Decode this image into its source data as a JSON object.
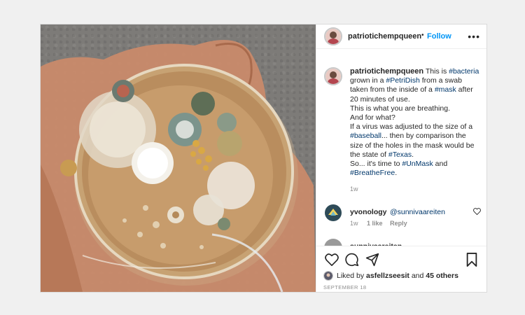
{
  "post": {
    "username": "patriotichempqueen",
    "follow_label": "Follow",
    "separator": "•",
    "more_label": "•••"
  },
  "caption": {
    "username": "patriotichempqueen",
    "line1_text": " This is ",
    "tag_bacteria": "#bacteria",
    "line2_pre": "grown in a ",
    "tag_petridish": "#PetriDish",
    "line2_post": " from a swab",
    "line3_pre": "taken from the inside of a ",
    "tag_mask": "#mask",
    "line3_post": " after",
    "line4": "20 minutes of use.",
    "line5": "This is what you are breathing.",
    "line6": "And for what?",
    "line7": "If a virus was adjusted to the size of a",
    "tag_baseball": "#baseball",
    "line8_post": "... then by comparison the",
    "line9": "size of the holes in the mask would be",
    "line10_pre": "the state of ",
    "tag_texas": "#Texas",
    "line10_post": ".",
    "line11_pre": "So... it's time to ",
    "tag_unmask": "#UnMask",
    "line11_post": " and",
    "tag_breathefree": "#BreatheFree",
    "line12_post": ".",
    "age": "1w"
  },
  "comments": [
    {
      "username": "yvonology",
      "mention": "@sunnivaareiten",
      "age": "1w",
      "likes": "1 like",
      "reply": "Reply"
    },
    {
      "username": "sunnivaareiten"
    }
  ],
  "footer": {
    "liked_prefix": "Liked by ",
    "liked_user": "asfellzseesit",
    "liked_mid": " and ",
    "liked_count": "45 others",
    "date": "SEPTEMBER 18"
  },
  "icons": {
    "like": "heart-icon",
    "comment": "comment-icon",
    "share": "share-icon",
    "save": "bookmark-icon",
    "more": "more-icon"
  },
  "colors": {
    "link": "#00376b",
    "follow": "#0095f6",
    "muted": "#8e8e8e"
  }
}
